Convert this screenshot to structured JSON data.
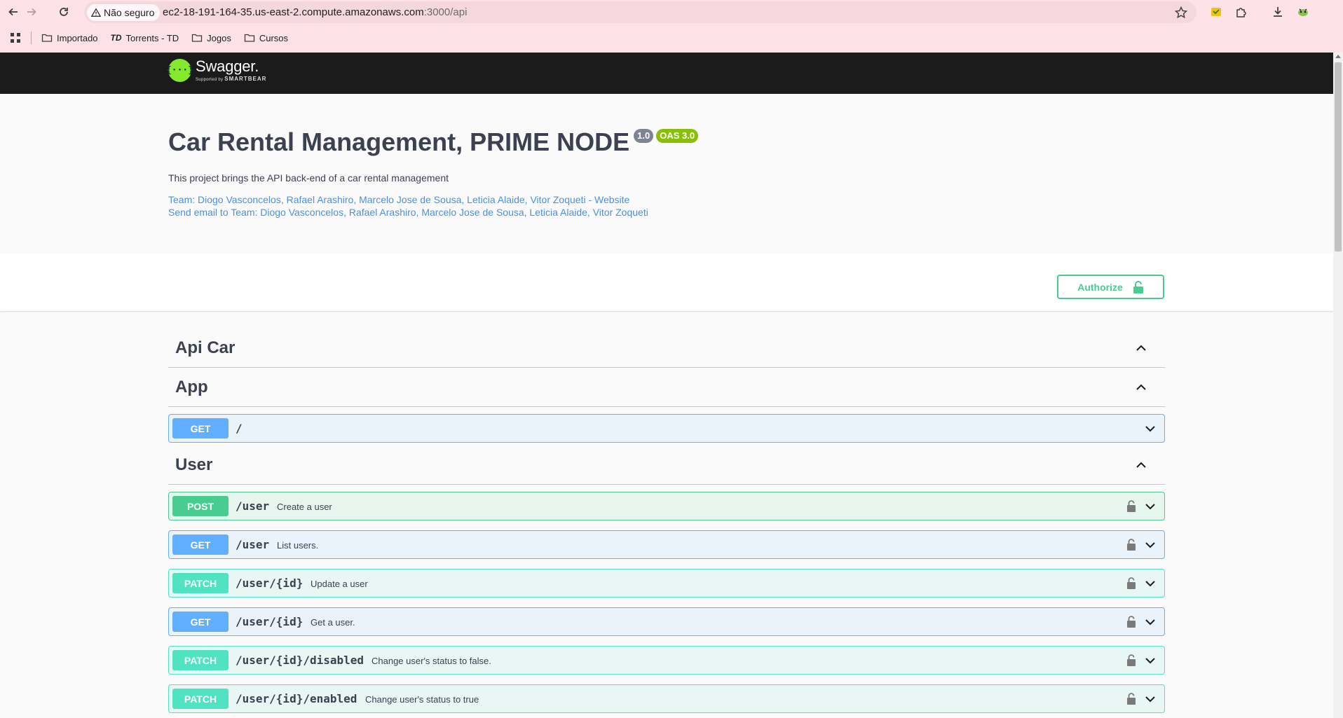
{
  "browser": {
    "security_label": "Não seguro",
    "url_main": "ec2-18-191-164-35.us-east-2.compute.amazonaws.com",
    "url_rest": ":3000/api",
    "bookmarks": [
      "Importado",
      "Torrents - TD",
      "Jogos",
      "Cursos"
    ]
  },
  "swagger": {
    "logo_title": "Swagger.",
    "logo_sub_prefix": "Supported by",
    "logo_sub_brand": "SMARTBEAR"
  },
  "info": {
    "title": "Car Rental Management, PRIME NODE",
    "version_badge": "1.0",
    "oas_badge": "OAS 3.0",
    "description": "This project brings the API back-end of a car rental management",
    "website_link": "Team: Diogo Vasconcelos, Rafael Arashiro, Marcelo Jose de Sousa, Leticia Alaide, Vitor Zoqueti - Website",
    "email_link": "Send email to Team: Diogo Vasconcelos, Rafael Arashiro, Marcelo Jose de Sousa, Leticia Alaide, Vitor Zoqueti"
  },
  "authorize_label": "Authorize",
  "tags": {
    "api_car": "Api Car",
    "app": "App",
    "user": "User"
  },
  "operations": [
    {
      "method": "GET",
      "path": "/",
      "summary": ""
    },
    {
      "method": "POST",
      "path": "/user",
      "summary": "Create a user"
    },
    {
      "method": "GET",
      "path": "/user",
      "summary": "List users."
    },
    {
      "method": "PATCH",
      "path": "/user/{id}",
      "summary": "Update a user"
    },
    {
      "method": "GET",
      "path": "/user/{id}",
      "summary": "Get a user."
    },
    {
      "method": "PATCH",
      "path": "/user/{id}/disabled",
      "summary": "Change user's status to false."
    },
    {
      "method": "PATCH",
      "path": "/user/{id}/enabled",
      "summary": "Change user's status to true"
    }
  ],
  "colors": {
    "get": "#61affe",
    "post": "#49cc90",
    "patch": "#50e3c2",
    "authorize": "#49cc90",
    "link": "#4990e2",
    "topbar": "#1b1b1b"
  }
}
